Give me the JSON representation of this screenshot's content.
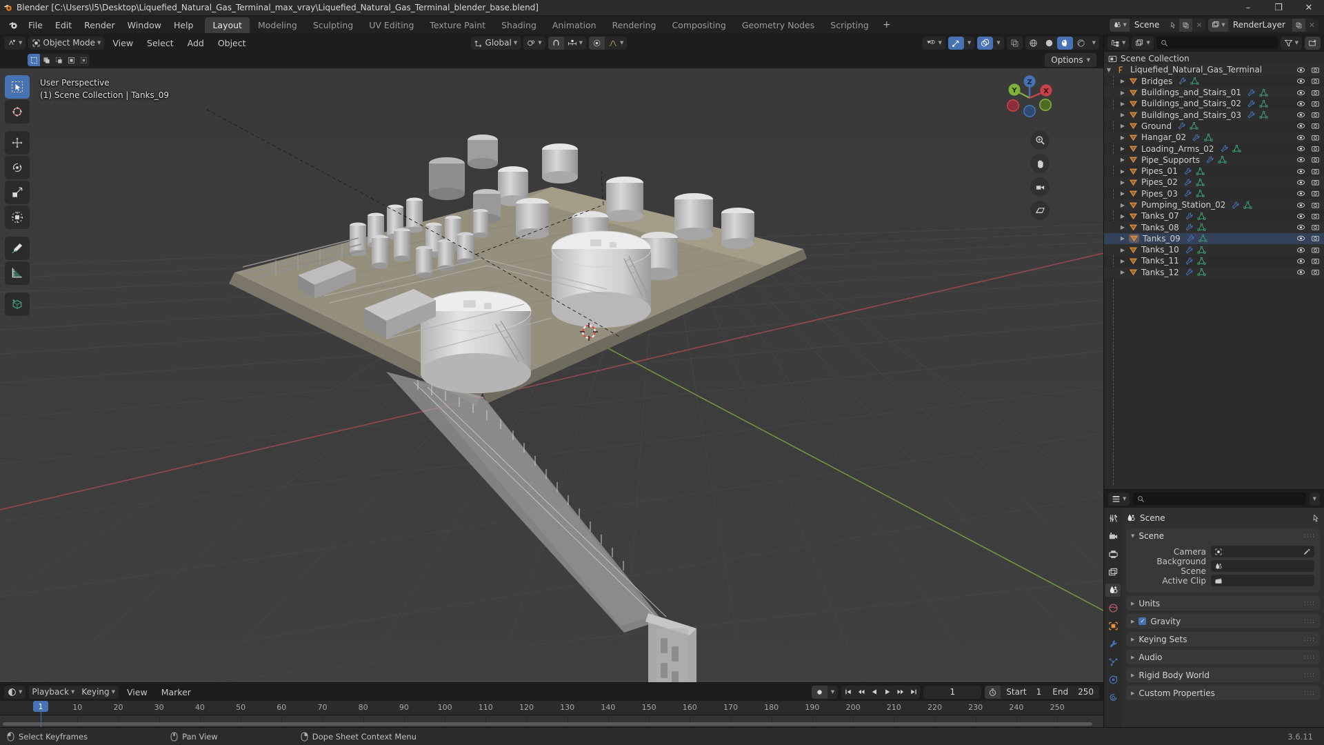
{
  "window": {
    "app_name": "Blender",
    "title": "Blender [C:\\Users\\l5\\Desktop\\Liquefied_Natural_Gas_Terminal_max_vray\\Liquefied_Natural_Gas_Terminal_blender_base.blend]",
    "minimize": "–",
    "maximize": "❐",
    "close": "✕"
  },
  "menus": [
    "File",
    "Edit",
    "Render",
    "Window",
    "Help"
  ],
  "workspace_tabs": [
    {
      "label": "Layout",
      "active": true
    },
    {
      "label": "Modeling",
      "active": false
    },
    {
      "label": "Sculpting",
      "active": false
    },
    {
      "label": "UV Editing",
      "active": false
    },
    {
      "label": "Texture Paint",
      "active": false
    },
    {
      "label": "Shading",
      "active": false
    },
    {
      "label": "Animation",
      "active": false
    },
    {
      "label": "Rendering",
      "active": false
    },
    {
      "label": "Compositing",
      "active": false
    },
    {
      "label": "Geometry Nodes",
      "active": false
    },
    {
      "label": "Scripting",
      "active": false
    }
  ],
  "workspace_add": "+",
  "topbar_right": {
    "scene_name": "Scene",
    "view_layer_name": "RenderLayer"
  },
  "viewport": {
    "mode": "Object Mode",
    "menus": [
      "View",
      "Select",
      "Add",
      "Object"
    ],
    "transform_orientation": "Global",
    "options_label": "Options",
    "overlay_line1": "User Perspective",
    "overlay_line2": "(1) Scene Collection | Tanks_09",
    "gizmo_axes": {
      "x": "X",
      "y": "Y",
      "z": "Z"
    },
    "tools": [
      "select-box-tool",
      "cursor-tool",
      "move-tool",
      "rotate-tool",
      "scale-tool",
      "transform-tool",
      "annotate-tool",
      "measure-tool",
      "add-cube-tool"
    ]
  },
  "outliner": {
    "search_placeholder": "",
    "root": "Scene Collection",
    "collection": "Liquefied_Natural_Gas_Terminal",
    "items": [
      {
        "label": "Bridges",
        "selected": false
      },
      {
        "label": "Buildings_and_Stairs_01",
        "selected": false
      },
      {
        "label": "Buildings_and_Stairs_02",
        "selected": false
      },
      {
        "label": "Buildings_and_Stairs_03",
        "selected": false
      },
      {
        "label": "Ground",
        "selected": false
      },
      {
        "label": "Hangar_02",
        "selected": false
      },
      {
        "label": "Loading_Arms_02",
        "selected": false
      },
      {
        "label": "Pipe_Supports",
        "selected": false
      },
      {
        "label": "Pipes_01",
        "selected": false
      },
      {
        "label": "Pipes_02",
        "selected": false
      },
      {
        "label": "Pipes_03",
        "selected": false
      },
      {
        "label": "Pumping_Station_02",
        "selected": false
      },
      {
        "label": "Tanks_07",
        "selected": false
      },
      {
        "label": "Tanks_08",
        "selected": false
      },
      {
        "label": "Tanks_09",
        "selected": true
      },
      {
        "label": "Tanks_10",
        "selected": false
      },
      {
        "label": "Tanks_11",
        "selected": false
      },
      {
        "label": "Tanks_12",
        "selected": false
      }
    ]
  },
  "properties": {
    "search_placeholder": "",
    "breadcrumb": "Scene",
    "panels": {
      "scene": {
        "title": "Scene",
        "camera_label": "Camera",
        "camera_value": "",
        "background_scene_label": "Background Scene",
        "background_scene_value": "",
        "active_clip_label": "Active Clip",
        "active_clip_value": ""
      }
    },
    "closed_panels": [
      {
        "label": "Units",
        "checkbox": false
      },
      {
        "label": "Gravity",
        "checkbox": true
      },
      {
        "label": "Keying Sets",
        "checkbox": false
      },
      {
        "label": "Audio",
        "checkbox": false
      },
      {
        "label": "Rigid Body World",
        "checkbox": false
      },
      {
        "label": "Custom Properties",
        "checkbox": false
      }
    ],
    "tabs": [
      "tool-tab",
      "render-tab",
      "output-tab",
      "view-layer-tab",
      "scene-tab",
      "world-tab",
      "object-tab",
      "modifier-tab",
      "particles-tab",
      "physics-tab",
      "constraints-tab"
    ]
  },
  "timeline": {
    "menus": [
      "Playback",
      "Keying",
      "View",
      "Marker"
    ],
    "current_frame": "1",
    "start_label": "Start",
    "start_value": "1",
    "end_label": "End",
    "end_value": "250",
    "ticks": [
      "1",
      "10",
      "20",
      "30",
      "40",
      "50",
      "60",
      "70",
      "80",
      "90",
      "100",
      "110",
      "120",
      "130",
      "140",
      "150",
      "160",
      "170",
      "180",
      "190",
      "200",
      "210",
      "220",
      "230",
      "240",
      "250"
    ]
  },
  "statusbar": {
    "items": [
      "Select Keyframes",
      "Pan View",
      "Dope Sheet Context Menu"
    ],
    "version": "3.6.11"
  }
}
